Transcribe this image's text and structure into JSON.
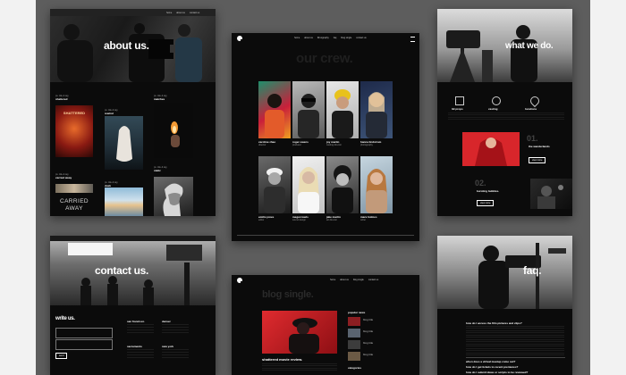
{
  "mockups": {
    "about": {
      "title": "about us.",
      "items": [
        {
          "label": "shattered",
          "meta": "ps. title & tag"
        },
        {
          "label": "rewind",
          "meta": "ps. title & tag"
        },
        {
          "label": "matches",
          "meta": "ps. title & tag"
        },
        {
          "label": "carried away",
          "meta": "ps. title & tag"
        },
        {
          "label": "dusk",
          "meta": "ps. title & tag"
        },
        {
          "label": "static",
          "meta": "ps. title & tag"
        }
      ],
      "poster_text": "SHATTERED",
      "carried_text": "CARRIED AWAY"
    },
    "crew": {
      "title": "our crew.",
      "nav": [
        "home",
        "about us",
        "filmography",
        "faq",
        "blog single",
        "contact us"
      ],
      "members": [
        {
          "name": "caroline zhao",
          "role": "director"
        },
        {
          "name": "roger owens",
          "role": "producer"
        },
        {
          "name": "joy martin",
          "role": "casting director"
        },
        {
          "name": "hanna lindstrom",
          "role": "photography"
        },
        {
          "name": "emilio jones",
          "role": "editor"
        },
        {
          "name": "megan lewis",
          "role": "sound design"
        },
        {
          "name": "jake martin",
          "role": "art director"
        },
        {
          "name": "mara holmes",
          "role": "writer"
        }
      ]
    },
    "whatwedo": {
      "title": "what we do.",
      "services": [
        "3d props",
        "casting",
        "locations"
      ],
      "feature1": "the wanderlands",
      "feature2": "bursting bubbles.",
      "cta": "view more"
    },
    "contact": {
      "title": "contact us.",
      "form_title": "write us.",
      "offices": [
        "san francisco",
        "denver",
        "sacramento",
        "new york"
      ],
      "send": "send"
    },
    "blog": {
      "title": "blog single.",
      "post_title": "shattered movie review.",
      "sidebar_title": "popular news",
      "news": [
        "blog title",
        "blog title",
        "blog title",
        "blog title"
      ],
      "cat_title": "categories"
    },
    "faq": {
      "title": "faq.",
      "questions": [
        "how do I access the film pictures and clips?",
        "when does a virtual meetup come out?",
        "how do I get tickets to recent premieres?",
        "how do I submit ideas or scripts to be reviewed?"
      ]
    }
  },
  "colors": {
    "accent_red": "#d8262b",
    "page_bg": "#0b0b0b",
    "backdrop": "#5d5d5d"
  }
}
